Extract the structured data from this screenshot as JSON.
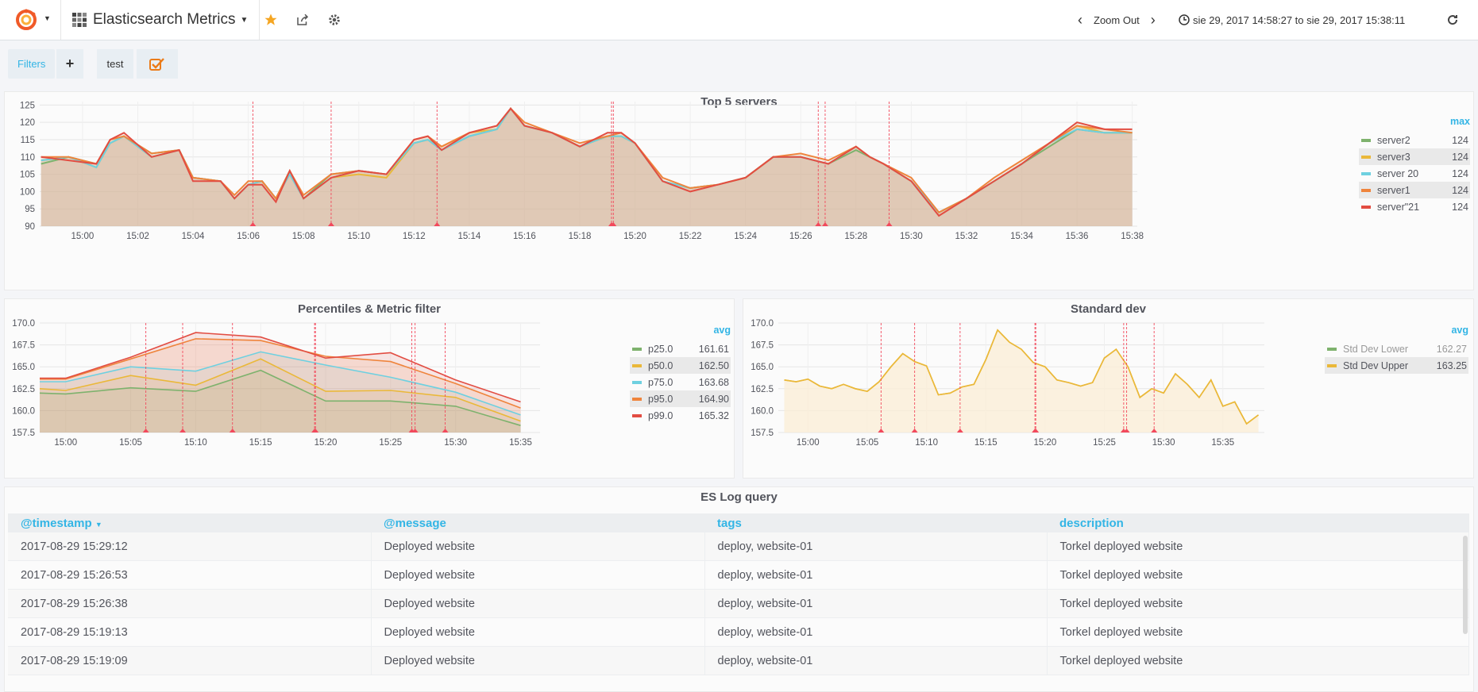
{
  "topbar": {
    "dashboard_title": "Elasticsearch Metrics",
    "zoom_out_label": "Zoom Out",
    "time_range": "sie 29, 2017 14:58:27 to sie 29, 2017 15:38:11"
  },
  "submenu": {
    "filters_label": "Filters",
    "add_label": "+",
    "test_label": "test"
  },
  "colors": {
    "server2": "#7eb26d",
    "server3": "#eab839",
    "server20": "#6ed0e0",
    "server1": "#ef843c",
    "server21": "#e24d42",
    "accent": "#33b5e5",
    "annotation": "#f2495c"
  },
  "panels": {
    "top5": {
      "title": "Top 5 servers",
      "legend_header": "max",
      "legend": [
        {
          "name": "server2",
          "value": "124"
        },
        {
          "name": "server3",
          "value": "124"
        },
        {
          "name": "server 20",
          "value": "124"
        },
        {
          "name": "server1",
          "value": "124"
        },
        {
          "name": "server\"21",
          "value": "124"
        }
      ]
    },
    "percentiles": {
      "title": "Percentiles & Metric filter",
      "legend_header": "avg",
      "legend": [
        {
          "name": "p25.0",
          "value": "161.61"
        },
        {
          "name": "p50.0",
          "value": "162.50"
        },
        {
          "name": "p75.0",
          "value": "163.68"
        },
        {
          "name": "p95.0",
          "value": "164.90"
        },
        {
          "name": "p99.0",
          "value": "165.32"
        }
      ]
    },
    "stddev": {
      "title": "Standard dev",
      "legend_header": "avg",
      "legend": [
        {
          "name": "Std Dev Lower",
          "value": "162.27"
        },
        {
          "name": "Std Dev Upper",
          "value": "163.25"
        }
      ]
    },
    "logs": {
      "title": "ES Log query",
      "columns": [
        "@timestamp",
        "@message",
        "tags",
        "description"
      ],
      "rows": [
        [
          "2017-08-29 15:29:12",
          "Deployed website",
          "deploy, website-01",
          "Torkel deployed website"
        ],
        [
          "2017-08-29 15:26:53",
          "Deployed website",
          "deploy, website-01",
          "Torkel deployed website"
        ],
        [
          "2017-08-29 15:26:38",
          "Deployed website",
          "deploy, website-01",
          "Torkel deployed website"
        ],
        [
          "2017-08-29 15:19:13",
          "Deployed website",
          "deploy, website-01",
          "Torkel deployed website"
        ],
        [
          "2017-08-29 15:19:09",
          "Deployed website",
          "deploy, website-01",
          "Torkel deployed website"
        ]
      ]
    }
  },
  "chart_data": [
    {
      "type": "line",
      "title": "Top 5 servers",
      "xlabel": "",
      "ylabel": "",
      "x_ticks": [
        "15:00",
        "15:02",
        "15:04",
        "15:06",
        "15:08",
        "15:10",
        "15:12",
        "15:14",
        "15:16",
        "15:18",
        "15:20",
        "15:22",
        "15:24",
        "15:26",
        "15:28",
        "15:30",
        "15:32",
        "15:34",
        "15:36",
        "15:38"
      ],
      "y_ticks": [
        90,
        95,
        100,
        105,
        110,
        115,
        120,
        125
      ],
      "ylim": [
        90,
        126
      ],
      "x": [
        "14:58:30",
        "14:59:30",
        "15:00:30",
        "15:01:00",
        "15:01:30",
        "15:02:30",
        "15:03:30",
        "15:04:00",
        "15:05:00",
        "15:05:30",
        "15:06:00",
        "15:06:30",
        "15:07:00",
        "15:07:30",
        "15:08:00",
        "15:09:00",
        "15:10:00",
        "15:11:00",
        "15:12:00",
        "15:12:30",
        "15:13:00",
        "15:14:00",
        "15:15:00",
        "15:15:30",
        "15:16:00",
        "15:17:00",
        "15:18:00",
        "15:19:00",
        "15:19:30",
        "15:20:00",
        "15:21:00",
        "15:22:00",
        "15:23:00",
        "15:24:00",
        "15:25:00",
        "15:26:00",
        "15:27:00",
        "15:28:00",
        "15:28:30",
        "15:29:00",
        "15:30:00",
        "15:31:00",
        "15:32:00",
        "15:33:00",
        "15:34:00",
        "15:35:00",
        "15:36:00",
        "15:37:00",
        "15:38:00"
      ],
      "series": [
        {
          "name": "server2",
          "values": [
            108,
            110,
            108,
            114,
            116,
            111,
            112,
            104,
            103,
            98,
            102,
            103,
            98,
            106,
            98,
            105,
            106,
            105,
            114,
            115,
            112,
            116,
            118,
            124,
            119,
            117,
            113,
            116,
            116,
            114,
            103,
            101,
            102,
            104,
            110,
            110,
            108,
            112,
            110,
            108,
            103,
            94,
            98,
            103,
            108,
            113,
            118,
            117,
            117
          ]
        },
        {
          "name": "server3",
          "values": [
            109,
            110,
            107,
            114,
            116,
            110,
            112,
            104,
            103,
            98,
            102,
            103,
            98,
            105,
            98,
            104,
            105,
            104,
            114,
            115,
            113,
            117,
            118,
            124,
            119,
            117,
            113,
            116,
            116,
            114,
            103,
            101,
            102,
            104,
            110,
            110,
            108,
            113,
            110,
            108,
            103,
            94,
            98,
            103,
            108,
            114,
            119,
            117,
            117
          ]
        },
        {
          "name": "server 20",
          "values": [
            109,
            110,
            107,
            114,
            116,
            110,
            112,
            104,
            103,
            98,
            102,
            103,
            98,
            105,
            98,
            104,
            106,
            105,
            114,
            115,
            112,
            116,
            118,
            124,
            119,
            117,
            113,
            116,
            116,
            114,
            103,
            101,
            102,
            104,
            110,
            110,
            108,
            113,
            110,
            108,
            103,
            94,
            98,
            103,
            108,
            114,
            118,
            117,
            117
          ]
        },
        {
          "name": "server1",
          "values": [
            110,
            110,
            108,
            115,
            116,
            111,
            112,
            104,
            103,
            99,
            103,
            103,
            98,
            106,
            99,
            105,
            106,
            105,
            115,
            116,
            113,
            117,
            119,
            124,
            120,
            117,
            114,
            116,
            117,
            114,
            104,
            101,
            102,
            104,
            110,
            111,
            109,
            113,
            110,
            108,
            104,
            94,
            98,
            104,
            109,
            114,
            119,
            118,
            117
          ]
        },
        {
          "name": "server\"21",
          "values": [
            110,
            109,
            108,
            115,
            117,
            110,
            112,
            103,
            103,
            98,
            102,
            102,
            97,
            106,
            98,
            104,
            106,
            105,
            115,
            116,
            112,
            117,
            119,
            124,
            119,
            117,
            113,
            117,
            117,
            114,
            103,
            100,
            102,
            104,
            110,
            110,
            108,
            113,
            110,
            108,
            103,
            93,
            98,
            103,
            108,
            114,
            120,
            118,
            118
          ]
        }
      ],
      "annotations": [
        "15:06:10",
        "15:09:00",
        "15:12:50",
        "15:19:09",
        "15:19:13",
        "15:26:38",
        "15:26:53",
        "15:29:12"
      ]
    },
    {
      "type": "line",
      "title": "Percentiles & Metric filter",
      "xlabel": "",
      "ylabel": "",
      "x_ticks": [
        "15:00",
        "15:05",
        "15:10",
        "15:15",
        "15:20",
        "15:25",
        "15:30",
        "15:35"
      ],
      "y_ticks": [
        157.5,
        160.0,
        162.5,
        165.0,
        167.5,
        170.0
      ],
      "ylim": [
        157.5,
        170.0
      ],
      "x": [
        "14:58:00",
        "15:00:00",
        "15:05:00",
        "15:10:00",
        "15:15:00",
        "15:20:00",
        "15:25:00",
        "15:30:00",
        "15:35:00"
      ],
      "series": [
        {
          "name": "p25.0",
          "values": [
            162.0,
            161.9,
            162.6,
            162.2,
            164.6,
            161.1,
            161.1,
            160.5,
            158.3
          ]
        },
        {
          "name": "p50.0",
          "values": [
            162.5,
            162.3,
            164.0,
            162.9,
            165.9,
            162.2,
            162.3,
            161.5,
            158.8
          ]
        },
        {
          "name": "p75.0",
          "values": [
            163.3,
            163.3,
            165.0,
            164.5,
            166.7,
            165.2,
            163.8,
            162.1,
            159.5
          ]
        },
        {
          "name": "p95.0",
          "values": [
            163.6,
            163.6,
            165.9,
            168.2,
            168.0,
            166.2,
            165.6,
            163.1,
            160.3
          ]
        },
        {
          "name": "p99.0",
          "values": [
            163.7,
            163.7,
            166.1,
            168.9,
            168.4,
            166.0,
            166.6,
            163.5,
            161.0
          ]
        }
      ],
      "annotations": [
        "15:06:10",
        "15:09:00",
        "15:12:50",
        "15:19:09",
        "15:19:13",
        "15:26:38",
        "15:26:53",
        "15:29:12"
      ]
    },
    {
      "type": "area",
      "title": "Standard dev",
      "xlabel": "",
      "ylabel": "",
      "x_ticks": [
        "15:00",
        "15:05",
        "15:10",
        "15:15",
        "15:20",
        "15:25",
        "15:30",
        "15:35"
      ],
      "y_ticks": [
        157.5,
        160.0,
        162.5,
        165.0,
        167.5,
        170.0
      ],
      "ylim": [
        157.5,
        170.0
      ],
      "x": [
        "14:58:00",
        "14:59:00",
        "15:00:00",
        "15:01:00",
        "15:02:00",
        "15:03:00",
        "15:04:00",
        "15:05:00",
        "15:06:00",
        "15:07:00",
        "15:08:00",
        "15:09:00",
        "15:10:00",
        "15:11:00",
        "15:12:00",
        "15:13:00",
        "15:14:00",
        "15:15:00",
        "15:16:00",
        "15:17:00",
        "15:18:00",
        "15:19:00",
        "15:20:00",
        "15:21:00",
        "15:22:00",
        "15:23:00",
        "15:24:00",
        "15:25:00",
        "15:26:00",
        "15:27:00",
        "15:28:00",
        "15:29:00",
        "15:30:00",
        "15:31:00",
        "15:32:00",
        "15:33:00",
        "15:34:00",
        "15:35:00",
        "15:36:00",
        "15:37:00",
        "15:38:00"
      ],
      "series": [
        {
          "name": "Std Dev Upper",
          "values": [
            163.5,
            163.3,
            163.6,
            162.8,
            162.5,
            163.0,
            162.5,
            162.2,
            163.3,
            165.0,
            166.5,
            165.6,
            165.1,
            161.8,
            162.0,
            162.7,
            163.0,
            165.8,
            169.2,
            167.8,
            167.0,
            165.5,
            165.0,
            163.5,
            163.2,
            162.8,
            163.2,
            166.0,
            167.0,
            165.0,
            161.5,
            162.5,
            162.0,
            164.2,
            163.0,
            161.5,
            163.5,
            160.5,
            161.0,
            158.5,
            159.5
          ]
        },
        {
          "name": "Std Dev Lower",
          "values": [
            163.5,
            163.3,
            163.6,
            162.8,
            162.5,
            163.0,
            162.5,
            162.2,
            163.3,
            165.0,
            166.5,
            165.6,
            165.1,
            161.8,
            162.0,
            162.7,
            163.0,
            165.8,
            169.2,
            167.8,
            167.0,
            165.5,
            165.0,
            163.5,
            163.2,
            162.8,
            163.2,
            166.0,
            167.0,
            165.0,
            161.5,
            162.5,
            162.0,
            164.2,
            163.0,
            161.5,
            163.5,
            160.5,
            161.0,
            158.5,
            159.5
          ]
        }
      ],
      "annotations": [
        "15:06:10",
        "15:09:00",
        "15:12:50",
        "15:19:09",
        "15:19:13",
        "15:26:38",
        "15:26:53",
        "15:29:12"
      ]
    }
  ]
}
